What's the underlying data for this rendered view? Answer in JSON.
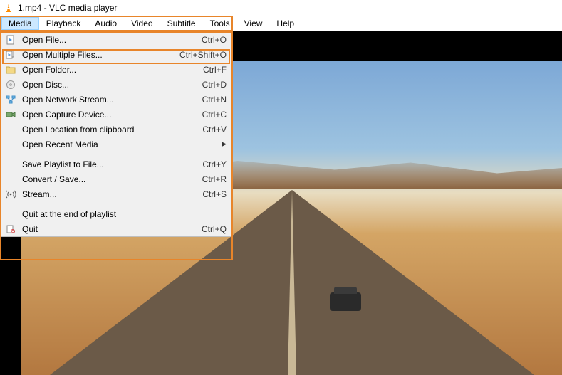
{
  "title": "1.mp4 - VLC media player",
  "menubar": {
    "media": "Media",
    "playback": "Playback",
    "audio": "Audio",
    "video": "Video",
    "subtitle": "Subtitle",
    "tools": "Tools",
    "view": "View",
    "help": "Help"
  },
  "menu": {
    "open_file": {
      "label": "Open File...",
      "shortcut": "Ctrl+O"
    },
    "open_multiple": {
      "label": "Open Multiple Files...",
      "shortcut": "Ctrl+Shift+O"
    },
    "open_folder": {
      "label": "Open Folder...",
      "shortcut": "Ctrl+F"
    },
    "open_disc": {
      "label": "Open Disc...",
      "shortcut": "Ctrl+D"
    },
    "open_network": {
      "label": "Open Network Stream...",
      "shortcut": "Ctrl+N"
    },
    "open_capture": {
      "label": "Open Capture Device...",
      "shortcut": "Ctrl+C"
    },
    "open_clipboard": {
      "label": "Open Location from clipboard",
      "shortcut": "Ctrl+V"
    },
    "open_recent": {
      "label": "Open Recent Media"
    },
    "save_playlist": {
      "label": "Save Playlist to File...",
      "shortcut": "Ctrl+Y"
    },
    "convert": {
      "label": "Convert / Save...",
      "shortcut": "Ctrl+R"
    },
    "stream": {
      "label": "Stream...",
      "shortcut": "Ctrl+S"
    },
    "quit_end": {
      "label": "Quit at the end of playlist"
    },
    "quit": {
      "label": "Quit",
      "shortcut": "Ctrl+Q"
    }
  }
}
